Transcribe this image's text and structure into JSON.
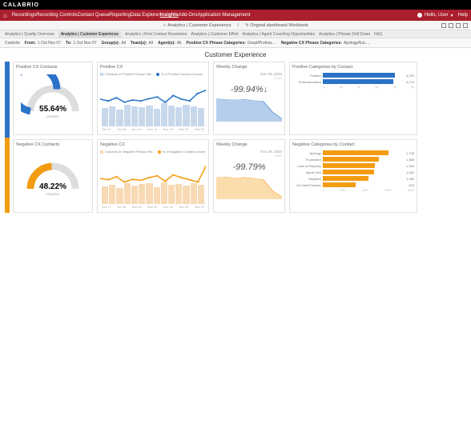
{
  "brand": "CALABRIO",
  "nav": {
    "items": [
      "Recordings",
      "Recording Controls",
      "Contact Queue",
      "Reporting",
      "Data Explorer",
      "Insights",
      "Add-Ons",
      "Application Management"
    ],
    "active": "Insights",
    "user_greeting": "Hello, User",
    "help": "Help"
  },
  "toolbar": {
    "left": "Analytics | Customer Experience",
    "right": "Original dashboard Workbook"
  },
  "breadcrumbs": [
    "Analytics | Quality Overview",
    "Analytics | Customer Experience",
    "Analytics | First Contact Resolution",
    "Analytics | Customer Effort",
    "Analytics | Agent Coaching Opportunities",
    "Analytics | Phrase Drill Down",
    "FAQ"
  ],
  "breadcrumb_active": 1,
  "controls": {
    "label": "Controls",
    "from": {
      "k": "From:",
      "v": "1 Oct Nov 07"
    },
    "to": {
      "k": "To:",
      "v": "1 Oct Nov 07"
    },
    "groups": {
      "k": "Group(s):",
      "v": "All"
    },
    "teams": {
      "k": "Team(s):",
      "v": "All"
    },
    "agents": {
      "k": "Agent(s):",
      "v": "All"
    },
    "pos_cat": {
      "k": "Positive CX Phrase Categories:",
      "v": "Great/Profess…"
    },
    "neg_cat": {
      "k": "Negative CX Phrase Categories:",
      "v": "Apology/Esc…"
    }
  },
  "page_title": "Customer Experience",
  "positive": {
    "gauge": {
      "title": "Positive CX Contacts",
      "value": 55.64,
      "label": "positive"
    },
    "combo": {
      "title": "Positive CX",
      "legend1": "Contacts w/ Positive Phrase Hits",
      "legend2": "% of Positive Contact Volume",
      "bars": [
        42,
        45,
        38,
        50,
        46,
        44,
        48,
        40,
        52,
        47,
        43,
        49,
        45,
        41
      ],
      "line": [
        62,
        58,
        65,
        55,
        60,
        58,
        63,
        67,
        55,
        70,
        62,
        58,
        75,
        82
      ],
      "axis": [
        "Oct 17",
        "Oct 28",
        "Nov 04",
        "Nov 11",
        "Nov 18",
        "Nov 25",
        "Dec 02"
      ]
    },
    "change": {
      "title": "Weekly Change",
      "date": "Nov 29, 2020",
      "sub": "1,915",
      "value": "-99.94%↓",
      "area": [
        95,
        92,
        90,
        93,
        88,
        85,
        40,
        12
      ]
    },
    "cats": {
      "title": "Positive Categories by Contact",
      "items": [
        {
          "label": "Positive",
          "value": 4293,
          "pct": 90
        },
        {
          "label": "Professionalism",
          "value": 4273,
          "pct": 88
        }
      ],
      "axis": [
        "0",
        "1k",
        "2k",
        "3k",
        "4k",
        "5k"
      ]
    }
  },
  "negative": {
    "gauge": {
      "title": "Negative CX Contacts",
      "value": 48.22,
      "label": "negative"
    },
    "combo": {
      "title": "Negative CX",
      "legend1": "Contacts w/ Negative Phrase Hits",
      "legend2": "% of Negative Contact volume",
      "bars": [
        40,
        44,
        36,
        48,
        42,
        45,
        47,
        39,
        50,
        44,
        46,
        42,
        48,
        44
      ],
      "line": [
        58,
        55,
        62,
        50,
        56,
        54,
        60,
        64,
        52,
        66,
        60,
        55,
        50,
        85
      ],
      "axis": [
        "Oct 17",
        "Oct 28",
        "Nov 04",
        "Nov 11",
        "Nov 18",
        "Nov 25",
        "Dec 02"
      ]
    },
    "change": {
      "title": "Weekly Change",
      "date": "Nov 29, 2020",
      "sub": "1,915",
      "value": "-99.79%",
      "area": [
        90,
        93,
        88,
        91,
        86,
        82,
        35,
        10
      ]
    },
    "cats": {
      "title": "Negative Categories by Contact",
      "items": [
        {
          "label": "Apology",
          "value": 1748,
          "pct": 82
        },
        {
          "label": "Frustration",
          "value": 1468,
          "pct": 70
        },
        {
          "label": "Lack of Empathy",
          "value": 1363,
          "pct": 65
        },
        {
          "label": "Agent Void",
          "value": 1352,
          "pct": 64
        },
        {
          "label": "Negative",
          "value": 1186,
          "pct": 57
        },
        {
          "label": "On-Hold/Transfer",
          "value": 825,
          "pct": 40
        }
      ],
      "axis": [
        "0",
        "500",
        "1000",
        "1500",
        "2000"
      ]
    }
  },
  "chart_data": [
    {
      "type": "gauge",
      "title": "Positive CX Contacts",
      "value": 55.64,
      "unit": "%",
      "range": [
        0,
        100
      ]
    },
    {
      "type": "gauge",
      "title": "Negative CX Contacts",
      "value": 48.22,
      "unit": "%",
      "range": [
        0,
        100
      ]
    },
    {
      "type": "bar-line",
      "title": "Positive CX",
      "categories": [
        "Oct 17",
        "Oct 28",
        "Nov 04",
        "Nov 11",
        "Nov 18",
        "Nov 25",
        "Dec 02"
      ],
      "series": [
        {
          "name": "Contacts w/ Positive Phrase Hits",
          "type": "bar",
          "values": [
            42,
            45,
            38,
            50,
            46,
            44,
            48,
            40,
            52,
            47,
            43,
            49,
            45,
            41
          ]
        },
        {
          "name": "% of Positive Contact Volume",
          "type": "line",
          "values": [
            62,
            58,
            65,
            55,
            60,
            58,
            63,
            67,
            55,
            70,
            62,
            58,
            75,
            82
          ]
        }
      ]
    },
    {
      "type": "bar-line",
      "title": "Negative CX",
      "categories": [
        "Oct 17",
        "Oct 28",
        "Nov 04",
        "Nov 11",
        "Nov 18",
        "Nov 25",
        "Dec 02"
      ],
      "series": [
        {
          "name": "Contacts w/ Negative Phrase Hits",
          "type": "bar",
          "values": [
            40,
            44,
            36,
            48,
            42,
            45,
            47,
            39,
            50,
            44,
            46,
            42,
            48,
            44
          ]
        },
        {
          "name": "% of Negative Contact volume",
          "type": "line",
          "values": [
            58,
            55,
            62,
            50,
            56,
            54,
            60,
            64,
            52,
            66,
            60,
            55,
            50,
            85
          ]
        }
      ]
    },
    {
      "type": "area",
      "title": "Weekly Change (Positive)",
      "value_label": "-99.94%",
      "x": [
        1,
        2,
        3,
        4,
        5,
        6,
        7,
        8
      ],
      "values": [
        95,
        92,
        90,
        93,
        88,
        85,
        40,
        12
      ]
    },
    {
      "type": "area",
      "title": "Weekly Change (Negative)",
      "value_label": "-99.79%",
      "x": [
        1,
        2,
        3,
        4,
        5,
        6,
        7,
        8
      ],
      "values": [
        90,
        93,
        88,
        91,
        86,
        82,
        35,
        10
      ]
    },
    {
      "type": "bar",
      "title": "Positive Categories by Contact",
      "orientation": "horizontal",
      "categories": [
        "Positive",
        "Professionalism"
      ],
      "values": [
        4293,
        4273
      ],
      "xlim": [
        0,
        5000
      ]
    },
    {
      "type": "bar",
      "title": "Negative Categories by Contact",
      "orientation": "horizontal",
      "categories": [
        "Apology",
        "Frustration",
        "Lack of Empathy",
        "Agent Void",
        "Negative",
        "On-Hold/Transfer"
      ],
      "values": [
        1748,
        1468,
        1363,
        1352,
        1186,
        825
      ],
      "xlim": [
        0,
        2000
      ]
    }
  ]
}
